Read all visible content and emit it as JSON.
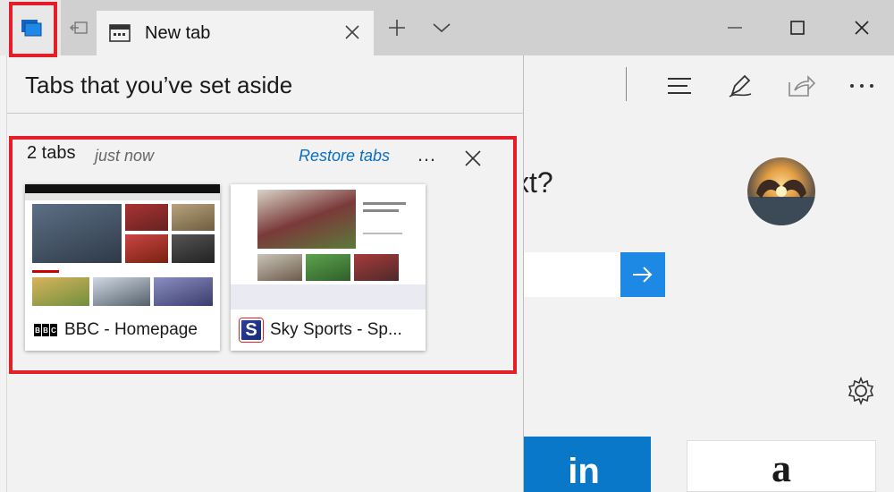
{
  "tab": {
    "title": "New tab"
  },
  "window_controls": {
    "minimize": "—",
    "maximize": "☐",
    "close": "✕"
  },
  "panel": {
    "title": "Tabs that you’ve set aside",
    "group": {
      "count_label": "2 tabs",
      "time_label": "just now",
      "restore_label": "Restore tabs",
      "more_label": "…",
      "tabs": [
        {
          "title": "BBC - Homepage",
          "favicon": "bbc-logo-icon"
        },
        {
          "title": "Sky Sports - Sp...",
          "favicon": "sky-sports-logo-icon"
        }
      ]
    }
  },
  "background_page": {
    "heading_fragment": "xt?",
    "tile_1_text": "in",
    "tile_2_text": "a"
  },
  "colors": {
    "highlight": "#e41e26",
    "accent": "#1e88e5",
    "link": "#0a6fc2"
  }
}
